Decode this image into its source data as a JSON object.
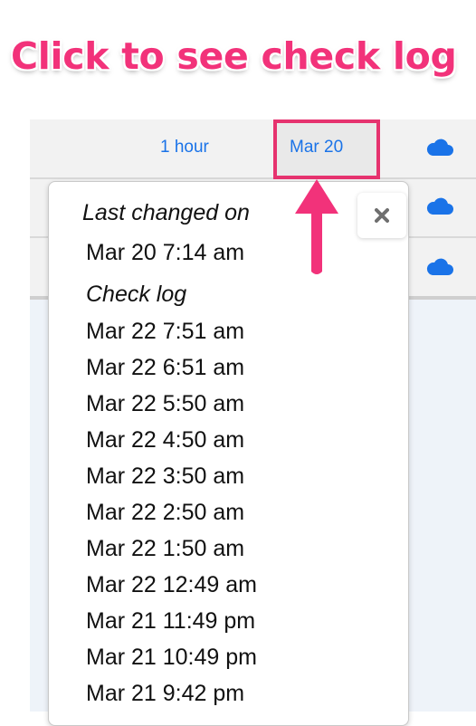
{
  "annotation": {
    "headline": "Click to see check log",
    "accent_color": "#f2327a"
  },
  "table": {
    "rows": [
      {
        "interval": "1 hour",
        "last_changed": "Mar 20",
        "status_icon": "cloud-icon"
      },
      {
        "interval": "",
        "last_changed": "",
        "status_icon": "cloud-icon"
      },
      {
        "interval": "",
        "last_changed": "",
        "status_icon": "cloud-icon"
      }
    ],
    "link_color": "#1a73e8",
    "highlight_color": "#e6336f"
  },
  "popover": {
    "close_icon": "close-icon",
    "last_changed_heading": "Last changed on",
    "last_changed_value": "Mar 20 7:14 am",
    "check_log_heading": "Check log",
    "check_log": [
      "Mar 22 7:51 am",
      "Mar 22 6:51 am",
      "Mar 22 5:50 am",
      "Mar 22 4:50 am",
      "Mar 22 3:50 am",
      "Mar 22 2:50 am",
      "Mar 22 1:50 am",
      "Mar 22 12:49 am",
      "Mar 21 11:49 pm",
      "Mar 21 10:49 pm",
      "Mar 21 9:42 pm"
    ]
  }
}
